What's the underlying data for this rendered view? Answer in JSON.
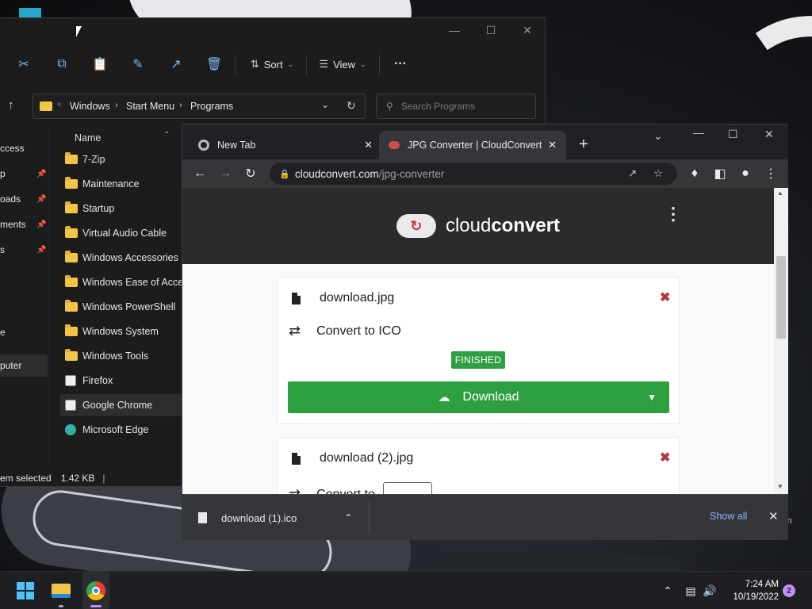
{
  "explorer": {
    "toolbar": {
      "sort_label": "Sort",
      "view_label": "View"
    },
    "breadcrumb": [
      "Windows",
      "Start Menu",
      "Programs"
    ],
    "search_placeholder": "Search Programs",
    "column_name": "Name",
    "nav_items": [
      "ccess",
      "p",
      "oads",
      "ments",
      "s",
      "e",
      "puter"
    ],
    "files": [
      {
        "name": "7-Zip",
        "icon": "folder-icon"
      },
      {
        "name": "Maintenance",
        "icon": "folder-icon"
      },
      {
        "name": "Startup",
        "icon": "folder-icon"
      },
      {
        "name": "Virtual Audio Cable",
        "icon": "folder-icon"
      },
      {
        "name": "Windows Accessories",
        "icon": "folder-icon"
      },
      {
        "name": "Windows Ease of Access",
        "icon": "folder-icon"
      },
      {
        "name": "Windows PowerShell",
        "icon": "folder-icon"
      },
      {
        "name": "Windows System",
        "icon": "folder-icon"
      },
      {
        "name": "Windows Tools",
        "icon": "folder-icon"
      },
      {
        "name": "Firefox",
        "icon": "shortcut-icon"
      },
      {
        "name": "Google Chrome",
        "icon": "shortcut-icon"
      },
      {
        "name": "Microsoft Edge",
        "icon": "edge-icon"
      }
    ],
    "status_selected": "em selected",
    "status_size": "1.42 KB"
  },
  "browser": {
    "tabs": [
      {
        "title": "New Tab"
      },
      {
        "title": "JPG Converter | CloudConvert"
      }
    ],
    "url_host": "cloudconvert.com",
    "url_path": "/jpg-converter",
    "logo_light": "cloud",
    "logo_bold": "convert",
    "file1": {
      "name": "download.jpg",
      "convert": "Convert to ICO",
      "status": "FINISHED",
      "download_label": "Download"
    },
    "file2": {
      "name": "download (2).jpg",
      "convert": "Convert to"
    },
    "download_bar": {
      "filename": "download (1).ico",
      "show_all": "Show all"
    }
  },
  "desktop": {
    "bin_fragment": "in"
  },
  "taskbar": {
    "time": "7:24 AM",
    "date": "10/19/2022",
    "notifications": "2"
  },
  "colors": {
    "finished_green": "#2ea043",
    "remove_red": "#b23a3a",
    "link_blue": "#8ab4f8"
  }
}
